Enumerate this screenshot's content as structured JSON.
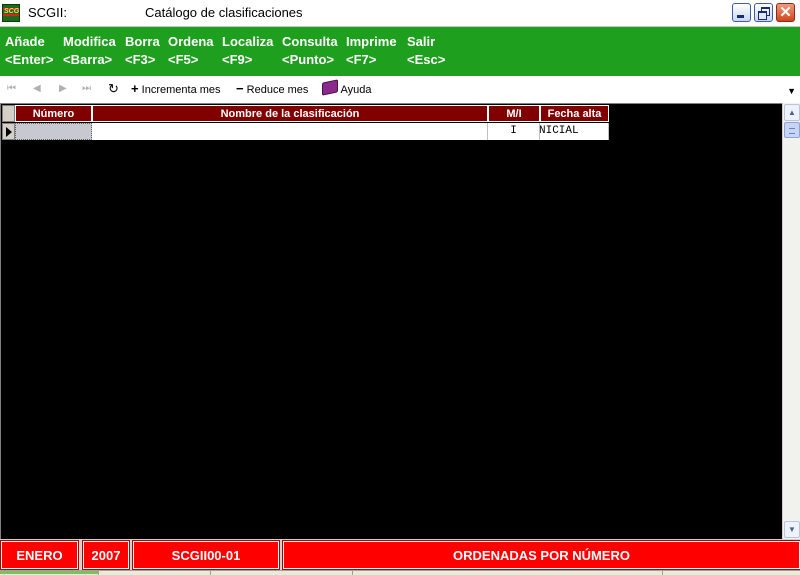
{
  "window": {
    "app_name": "SCGII:",
    "title": "Catálogo de clasificaciones",
    "logo_text": "SCG"
  },
  "menu": [
    {
      "label": "Añade",
      "key": "<Enter>"
    },
    {
      "label": "Modifica",
      "key": "<Barra>"
    },
    {
      "label": "Borra",
      "key": "<F3>"
    },
    {
      "label": "Ordena",
      "key": "<F5>"
    },
    {
      "label": "Localiza",
      "key": "<F9>"
    },
    {
      "label": "Consulta",
      "key": "<Punto>"
    },
    {
      "label": "Imprime",
      "key": "<F7>"
    },
    {
      "label": "Salir",
      "key": "<Esc>"
    }
  ],
  "toolbar": {
    "first_icon": "⏮",
    "prev_icon": "◀",
    "next_icon": "▶",
    "last_icon": "⏭",
    "refresh_icon": "↻",
    "increment_label": "Incrementa mes",
    "reduce_label": "Reduce mes",
    "help_label": "Ayuda"
  },
  "grid": {
    "columns": [
      "Número",
      "Nombre de la clasificación",
      "M/I",
      "Fecha alta"
    ],
    "rows": [
      {
        "numero": "",
        "nombre": "",
        "mi": "I",
        "fecha": "NICIAL"
      }
    ]
  },
  "status": {
    "month": "ENERO",
    "year": "2007",
    "code": "SCGII00-01",
    "order": "ORDENADAS POR NÚMERO"
  },
  "colors": {
    "menu_bg": "#1ea01e",
    "header_bg": "#800000",
    "status_bg": "#ff0000",
    "grid_bg": "#000000"
  }
}
